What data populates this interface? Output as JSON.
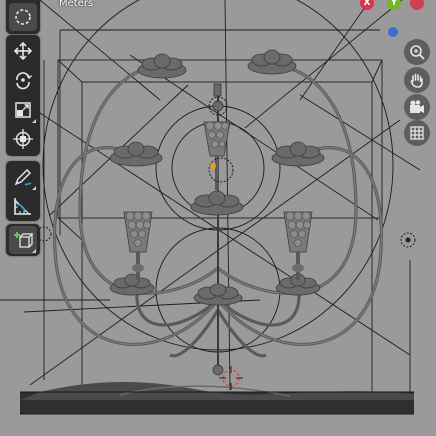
{
  "viewport": {
    "units_label": "Meters",
    "gizmo": {
      "x_label": "X",
      "y_label": "Y",
      "x_color": "#d8344a",
      "y_color": "#74b62a",
      "z_color": "#3b6fd0"
    }
  },
  "toolbar": {
    "tools": [
      {
        "name": "select-tool",
        "icon": "select-circle-icon",
        "active": true
      },
      {
        "name": "move-tool",
        "icon": "move-arrows-icon"
      },
      {
        "name": "rotate-tool",
        "icon": "rotate-icon"
      },
      {
        "name": "scale-tool",
        "icon": "scale-icon"
      },
      {
        "name": "transform-tool",
        "icon": "transform-icon"
      },
      {
        "name": "annotate-tool",
        "icon": "pencil-icon"
      },
      {
        "name": "measure-tool",
        "icon": "ruler-icon"
      },
      {
        "name": "add-cube-tool",
        "icon": "add-cube-icon"
      }
    ]
  },
  "navigation": [
    "zoom-icon",
    "hand-pan-icon",
    "camera-icon",
    "grid-icon"
  ],
  "colors": {
    "viewport_bg": "#9a9a9a",
    "toolbar_bg": "#2b2b2b",
    "active_tool": "#4a4a4a",
    "nav_button": "#5e5e5e",
    "cursor": "#e04848"
  }
}
